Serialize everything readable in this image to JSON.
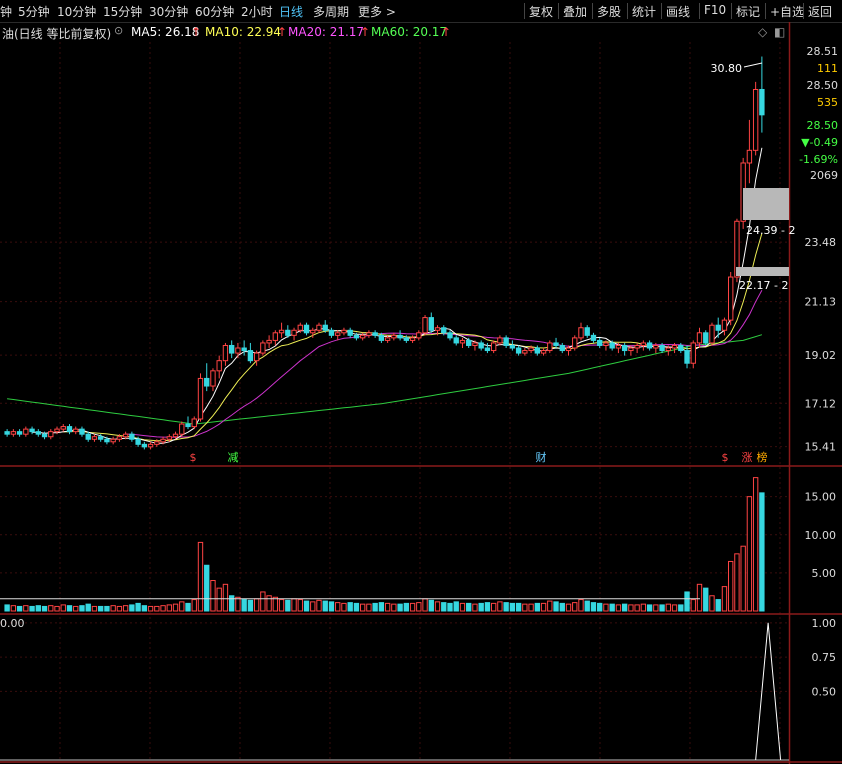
{
  "toolbar": {
    "periods": [
      "钟",
      "5分钟",
      "10分钟",
      "15分钟",
      "30分钟",
      "60分钟",
      "2小时",
      "日线",
      "多周期",
      "更多 >"
    ],
    "active_period": "日线",
    "right_buttons": [
      "复权",
      "叠加",
      "多股",
      "统计",
      "画线",
      "F10",
      "标记",
      "+自选",
      "返回"
    ]
  },
  "ma_bar": {
    "title": "油(日线 等比前复权)",
    "ma5": "MA5: 26.18",
    "ma10": "MA10: 22.94",
    "ma20": "MA20: 21.17",
    "ma60": "MA60: 20.17",
    "colors": {
      "ma5": "#ffffff",
      "ma10": "#ffff55",
      "ma20": "#ff55ff",
      "ma60": "#55ff55"
    }
  },
  "quote_panel": {
    "price_high": "28.51",
    "vol1": "111",
    "price2": "28.50",
    "vol2": "535",
    "last": "28.50",
    "change": "▼-0.49",
    "pct": "-1.69%",
    "vol3": "2069"
  },
  "price_axis": {
    "ticks": [
      "23.48",
      "21.13",
      "19.02",
      "17.12",
      "15.41"
    ]
  },
  "annotations": {
    "high_label": "30.80",
    "box1_label": "24.39 - 2",
    "box2_label": "22.17 - 2",
    "markers": [
      {
        "text": "$",
        "color": "#ff4444"
      },
      {
        "text": "减",
        "color": "#44ff44"
      },
      {
        "text": "财",
        "color": "#66ccff"
      },
      {
        "text": "$",
        "color": "#ff4444"
      },
      {
        "text": "涨",
        "color": "#ff4444"
      },
      {
        "text": "榜",
        "color": "#ffaa00"
      }
    ]
  },
  "volume_axis": {
    "ticks": [
      "15.00",
      "10.00",
      "5.00"
    ]
  },
  "indicator": {
    "label": "0.00",
    "ticks": [
      "1.00",
      "0.75",
      "0.50"
    ]
  },
  "colors": {
    "up": "#ff4444",
    "down": "#36d7e0",
    "grid": "#3a0d0d",
    "border": "#8b1a1a"
  },
  "chart_data": {
    "type": "candlestick",
    "price_ylim": [
      15.0,
      30.9
    ],
    "volume_ylim": [
      0,
      18.5
    ],
    "indicator_ylim": [
      0,
      1.05
    ],
    "candles": [
      [
        16.0,
        16.1,
        15.8,
        15.9,
        0.8
      ],
      [
        15.9,
        16.1,
        15.8,
        16.0,
        0.7
      ],
      [
        16.0,
        16.1,
        15.8,
        15.9,
        0.6
      ],
      [
        15.9,
        16.2,
        15.8,
        16.1,
        0.7
      ],
      [
        16.1,
        16.2,
        15.9,
        16.0,
        0.6
      ],
      [
        16.0,
        16.1,
        15.8,
        15.9,
        0.7
      ],
      [
        15.9,
        16.0,
        15.7,
        15.8,
        0.6
      ],
      [
        15.8,
        16.1,
        15.7,
        16.0,
        0.7
      ],
      [
        16.0,
        16.2,
        15.9,
        16.1,
        0.6
      ],
      [
        16.1,
        16.3,
        16.0,
        16.2,
        0.8
      ],
      [
        16.2,
        16.3,
        15.9,
        16.0,
        0.7
      ],
      [
        16.0,
        16.2,
        15.9,
        16.1,
        0.6
      ],
      [
        16.1,
        16.2,
        15.8,
        15.9,
        0.7
      ],
      [
        15.9,
        16.0,
        15.6,
        15.7,
        0.9
      ],
      [
        15.7,
        15.9,
        15.6,
        15.8,
        0.6
      ],
      [
        15.8,
        15.9,
        15.6,
        15.7,
        0.6
      ],
      [
        15.7,
        15.8,
        15.5,
        15.6,
        0.6
      ],
      [
        15.6,
        15.8,
        15.5,
        15.7,
        0.7
      ],
      [
        15.7,
        15.9,
        15.6,
        15.8,
        0.6
      ],
      [
        15.8,
        16.0,
        15.7,
        15.9,
        0.7
      ],
      [
        15.9,
        16.0,
        15.6,
        15.7,
        0.8
      ],
      [
        15.7,
        15.8,
        15.4,
        15.5,
        1.0
      ],
      [
        15.5,
        15.6,
        15.3,
        15.4,
        0.7
      ],
      [
        15.4,
        15.6,
        15.3,
        15.5,
        0.6
      ],
      [
        15.5,
        15.7,
        15.4,
        15.6,
        0.6
      ],
      [
        15.6,
        15.8,
        15.5,
        15.7,
        0.7
      ],
      [
        15.7,
        15.9,
        15.6,
        15.8,
        0.8
      ],
      [
        15.8,
        16.0,
        15.7,
        15.9,
        0.9
      ],
      [
        15.9,
        16.4,
        15.8,
        16.3,
        1.2
      ],
      [
        16.3,
        16.6,
        16.1,
        16.2,
        1.0
      ],
      [
        16.2,
        16.6,
        16.1,
        16.5,
        1.5
      ],
      [
        16.5,
        18.3,
        16.4,
        18.1,
        9.0
      ],
      [
        18.1,
        18.7,
        17.6,
        17.8,
        6.0
      ],
      [
        17.8,
        18.5,
        17.6,
        18.4,
        4.0
      ],
      [
        18.4,
        19.0,
        18.1,
        18.8,
        3.0
      ],
      [
        18.8,
        19.5,
        18.6,
        19.4,
        3.5
      ],
      [
        19.4,
        19.6,
        18.9,
        19.1,
        2.0
      ],
      [
        19.1,
        19.5,
        18.9,
        19.3,
        1.8
      ],
      [
        19.3,
        19.6,
        19.0,
        19.2,
        1.5
      ],
      [
        19.2,
        19.5,
        18.7,
        18.8,
        1.4
      ],
      [
        18.8,
        19.2,
        18.6,
        19.1,
        1.6
      ],
      [
        19.1,
        19.6,
        19.0,
        19.5,
        2.5
      ],
      [
        19.5,
        19.8,
        19.3,
        19.6,
        2.0
      ],
      [
        19.6,
        20.0,
        19.4,
        19.9,
        1.8
      ],
      [
        19.9,
        20.3,
        19.7,
        20.0,
        1.5
      ],
      [
        20.0,
        20.2,
        19.7,
        19.8,
        1.4
      ],
      [
        19.8,
        20.1,
        19.6,
        20.0,
        1.6
      ],
      [
        20.0,
        20.3,
        19.9,
        20.2,
        1.5
      ],
      [
        20.2,
        20.3,
        19.8,
        19.9,
        1.3
      ],
      [
        19.9,
        20.1,
        19.7,
        20.0,
        1.2
      ],
      [
        20.0,
        20.3,
        19.9,
        20.2,
        1.4
      ],
      [
        20.2,
        20.4,
        19.9,
        20.0,
        1.3
      ],
      [
        20.0,
        20.1,
        19.7,
        19.8,
        1.2
      ],
      [
        19.8,
        20.0,
        19.6,
        19.9,
        1.1
      ],
      [
        19.9,
        20.1,
        19.8,
        20.0,
        1.0
      ],
      [
        20.0,
        20.1,
        19.7,
        19.8,
        1.1
      ],
      [
        19.8,
        19.9,
        19.6,
        19.7,
        1.0
      ],
      [
        19.7,
        19.9,
        19.6,
        19.8,
        0.9
      ],
      [
        19.8,
        20.0,
        19.7,
        19.9,
        0.9
      ],
      [
        19.9,
        20.0,
        19.7,
        19.8,
        1.0
      ],
      [
        19.8,
        19.9,
        19.5,
        19.6,
        1.1
      ],
      [
        19.6,
        19.8,
        19.5,
        19.7,
        1.0
      ],
      [
        19.7,
        19.9,
        19.6,
        19.8,
        0.9
      ],
      [
        19.8,
        20.0,
        19.6,
        19.7,
        0.9
      ],
      [
        19.7,
        19.8,
        19.5,
        19.6,
        1.0
      ],
      [
        19.6,
        19.8,
        19.5,
        19.7,
        1.0
      ],
      [
        19.7,
        20.0,
        19.6,
        19.9,
        1.1
      ],
      [
        19.9,
        20.6,
        19.8,
        20.5,
        1.6
      ],
      [
        20.5,
        20.7,
        19.9,
        20.0,
        1.4
      ],
      [
        20.0,
        20.2,
        19.8,
        20.1,
        1.2
      ],
      [
        20.1,
        20.2,
        19.8,
        19.9,
        1.1
      ],
      [
        19.9,
        20.0,
        19.6,
        19.7,
        1.0
      ],
      [
        19.7,
        19.8,
        19.4,
        19.5,
        1.2
      ],
      [
        19.5,
        19.7,
        19.3,
        19.6,
        1.0
      ],
      [
        19.6,
        19.7,
        19.3,
        19.4,
        1.0
      ],
      [
        19.4,
        19.6,
        19.2,
        19.5,
        0.9
      ],
      [
        19.5,
        19.6,
        19.2,
        19.3,
        1.0
      ],
      [
        19.3,
        19.5,
        19.1,
        19.2,
        1.1
      ],
      [
        19.2,
        19.6,
        19.1,
        19.5,
        1.0
      ],
      [
        19.5,
        19.8,
        19.4,
        19.7,
        1.2
      ],
      [
        19.7,
        19.8,
        19.3,
        19.4,
        1.1
      ],
      [
        19.4,
        19.6,
        19.2,
        19.3,
        1.0
      ],
      [
        19.3,
        19.4,
        19.0,
        19.1,
        1.0
      ],
      [
        19.1,
        19.3,
        19.0,
        19.2,
        0.9
      ],
      [
        19.2,
        19.4,
        19.1,
        19.3,
        0.9
      ],
      [
        19.3,
        19.4,
        19.0,
        19.1,
        1.0
      ],
      [
        19.1,
        19.3,
        19.0,
        19.2,
        1.0
      ],
      [
        19.2,
        19.6,
        19.1,
        19.5,
        1.3
      ],
      [
        19.5,
        19.7,
        19.3,
        19.4,
        1.2
      ],
      [
        19.4,
        19.5,
        19.1,
        19.2,
        1.0
      ],
      [
        19.2,
        19.4,
        19.0,
        19.3,
        0.9
      ],
      [
        19.3,
        19.8,
        19.2,
        19.7,
        1.1
      ],
      [
        19.7,
        20.3,
        19.6,
        20.1,
        1.5
      ],
      [
        20.1,
        20.2,
        19.7,
        19.8,
        1.3
      ],
      [
        19.8,
        19.9,
        19.5,
        19.6,
        1.1
      ],
      [
        19.6,
        19.7,
        19.3,
        19.4,
        1.0
      ],
      [
        19.4,
        19.6,
        19.2,
        19.5,
        0.9
      ],
      [
        19.5,
        19.6,
        19.2,
        19.3,
        0.9
      ],
      [
        19.3,
        19.5,
        19.1,
        19.4,
        0.8
      ],
      [
        19.4,
        19.5,
        19.0,
        19.2,
        0.9
      ],
      [
        19.2,
        19.4,
        19.0,
        19.3,
        0.8
      ],
      [
        19.3,
        19.5,
        19.1,
        19.4,
        0.8
      ],
      [
        19.4,
        19.6,
        19.2,
        19.5,
        0.9
      ],
      [
        19.5,
        19.6,
        19.2,
        19.3,
        0.8
      ],
      [
        19.3,
        19.5,
        19.1,
        19.4,
        0.8
      ],
      [
        19.4,
        19.5,
        19.1,
        19.2,
        0.8
      ],
      [
        19.2,
        19.4,
        19.0,
        19.3,
        0.9
      ],
      [
        19.3,
        19.5,
        19.1,
        19.4,
        0.8
      ],
      [
        19.4,
        19.5,
        19.1,
        19.2,
        0.8
      ],
      [
        19.2,
        19.4,
        18.5,
        18.7,
        2.5
      ],
      [
        18.7,
        19.6,
        18.5,
        19.5,
        1.5
      ],
      [
        19.5,
        20.1,
        19.3,
        19.9,
        3.5
      ],
      [
        19.9,
        20.0,
        19.4,
        19.5,
        3.0
      ],
      [
        19.5,
        20.3,
        19.4,
        20.2,
        2.0
      ],
      [
        20.2,
        20.5,
        19.7,
        20.0,
        1.5
      ],
      [
        20.0,
        20.5,
        19.8,
        20.4,
        3.2
      ],
      [
        20.4,
        22.3,
        20.2,
        22.1,
        6.5
      ],
      [
        22.1,
        24.4,
        21.9,
        24.3,
        7.5
      ],
      [
        24.3,
        26.8,
        24.0,
        26.6,
        8.5
      ],
      [
        26.6,
        28.3,
        25.8,
        27.1,
        15.0
      ],
      [
        27.1,
        29.8,
        26.9,
        29.5,
        17.5
      ],
      [
        29.5,
        30.8,
        27.8,
        28.5,
        15.5
      ]
    ],
    "ma60": [
      [
        0,
        17.3
      ],
      [
        30,
        16.3
      ],
      [
        60,
        17.1
      ],
      [
        90,
        18.3
      ],
      [
        110,
        19.4
      ],
      [
        118,
        19.6
      ],
      [
        126,
        20.2
      ]
    ],
    "indicator_spike": {
      "index": 122,
      "value": 1.0
    }
  }
}
